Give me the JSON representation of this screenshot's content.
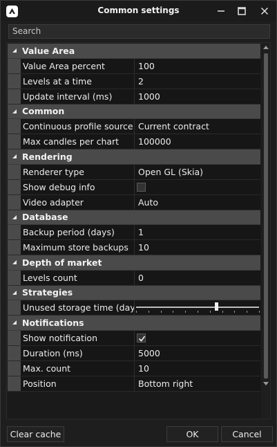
{
  "window": {
    "title": "Common settings"
  },
  "search": {
    "placeholder": "Search"
  },
  "categories": [
    {
      "label": "Value Area",
      "props": [
        {
          "name": "Value Area percent",
          "value": "100"
        },
        {
          "name": "Levels at a time",
          "value": "2"
        },
        {
          "name": "Update interval (ms)",
          "value": "1000"
        }
      ]
    },
    {
      "label": "Common",
      "props": [
        {
          "name": "Continuous profile source",
          "value": "Current contract"
        },
        {
          "name": "Max candles per chart",
          "value": "100000"
        }
      ]
    },
    {
      "label": "Rendering",
      "props": [
        {
          "name": "Renderer type",
          "value": "Open GL (Skia)"
        },
        {
          "name": "Show debug info",
          "value": ""
        },
        {
          "name": "Video adapter",
          "value": "Auto"
        }
      ]
    },
    {
      "label": "Database",
      "props": [
        {
          "name": "Backup period (days)",
          "value": "1"
        },
        {
          "name": "Maximum store backups",
          "value": "10"
        }
      ]
    },
    {
      "label": "Depth of market",
      "props": [
        {
          "name": "Levels count",
          "value": "0"
        }
      ]
    },
    {
      "label": "Strategies",
      "props": [
        {
          "name": "Unused storage time (days)",
          "value": ""
        }
      ]
    },
    {
      "label": "Notifications",
      "props": [
        {
          "name": "Show notification",
          "value": ""
        },
        {
          "name": "Duration (ms)",
          "value": "5000"
        },
        {
          "name": "Max. count",
          "value": "10"
        },
        {
          "name": "Position",
          "value": "Bottom right"
        }
      ]
    }
  ],
  "controls": {
    "show_debug_info_checked": false,
    "show_notification_checked": true,
    "unused_storage_slider_fraction": 0.65
  },
  "buttons": {
    "clear_cache": "Clear cache",
    "ok": "OK",
    "cancel": "Cancel"
  },
  "colors": {
    "category_bg": "#4a4a4a",
    "window_bg": "#1e1e1e",
    "accent": "#f0f0f0"
  }
}
